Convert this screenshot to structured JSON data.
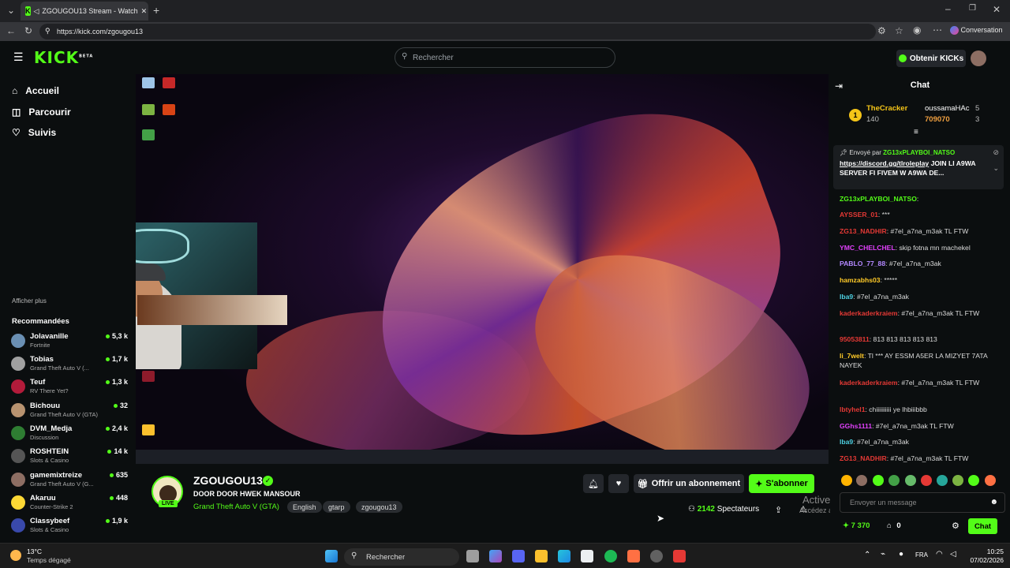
{
  "browser": {
    "tab_title": "ZGOUGOU13 Stream - Watch",
    "url": "https://kick.com/zgougou13",
    "conversation": "Conversation"
  },
  "header": {
    "logo": "KICK",
    "logo_sup": "BETA",
    "search_placeholder": "Rechercher",
    "kicks_button": "Obtenir KICKs"
  },
  "nav": {
    "home": "Accueil",
    "browse": "Parcourir",
    "following": "Suivis",
    "show_more": "Afficher plus",
    "recommended_title": "Recommandées"
  },
  "recommended": [
    {
      "name": "Jolavanille",
      "category": "Fortnite",
      "viewers": "5,3 k",
      "color": "#6a8fb3"
    },
    {
      "name": "Tobias",
      "category": "Grand Theft Auto V (...",
      "viewers": "1,7 k",
      "color": "#a0a0a0"
    },
    {
      "name": "Teuf",
      "category": "RV There Yet?",
      "viewers": "1,3 k",
      "color": "#b31b3a"
    },
    {
      "name": "Bichouu",
      "category": "Grand Theft Auto V (GTA)",
      "viewers": "32",
      "color": "#b89370"
    },
    {
      "name": "DVM_Medja",
      "category": "Discussion",
      "viewers": "2,4 k",
      "color": "#2e7d32"
    },
    {
      "name": "ROSHTEIN",
      "category": "Slots & Casino",
      "viewers": "14 k",
      "color": "#555"
    },
    {
      "name": "gamemixtreize",
      "category": "Grand Theft Auto V (G...",
      "viewers": "635",
      "color": "#8d6e63"
    },
    {
      "name": "Akaruu",
      "category": "Counter-Strike 2",
      "viewers": "448",
      "color": "#fdd835"
    },
    {
      "name": "Classybeef",
      "category": "Slots & Casino",
      "viewers": "1,9 k",
      "color": "#3949ab"
    }
  ],
  "stream": {
    "streamer": "ZGOUGOU13",
    "title": "DOOR DOOR HWEK MANSOUR",
    "category": "Grand Theft Auto V (GTA)",
    "tags": [
      "English",
      "gtarp",
      "zgougou13"
    ],
    "live": "LIVE",
    "gift_button": "Offrir un abonnement",
    "subscribe_button": "S'abonner",
    "viewers_count": "2142",
    "viewers_label": "Spectateurs"
  },
  "watermark": {
    "line1": "Activer Windows",
    "line2": "Accédez aux paramètres pour activer Windows."
  },
  "chat": {
    "title": "Chat",
    "leaderboard": [
      {
        "rank": "1",
        "name": "TheCracker",
        "value": "140"
      },
      {
        "name": "oussamaHAc",
        "value": "5"
      },
      {
        "name": "",
        "value": "709070",
        "extra": "3"
      }
    ],
    "pinned": {
      "sent_by": "Envoyé par",
      "user": "ZG13xPLAYBOI_NATSO",
      "link": "https://discord.gg/tlroleplay",
      "text": "JOIN LI A9WA SERVER FI FIVEM W A9WA DE..."
    },
    "messages": [
      {
        "user": "ZG13xPLAYBOI_NATSO",
        "text": ":",
        "color": "#53fc18"
      },
      {
        "user": "AYSSER_01",
        "text": ": ***",
        "color": "#e53935"
      },
      {
        "user": "ZG13_NADHIR",
        "text": ": #7el_a7na_m3ak TL FTW",
        "color": "#e53935"
      },
      {
        "user": "YMC_CHELCHEL",
        "text": ": skip fotna mn machekel",
        "color": "#e040fb"
      },
      {
        "user": "PABLO_77_88",
        "text": ": #7el_a7na_m3ak",
        "color": "#b388ff"
      },
      {
        "user": "hamzabhs03",
        "text": ": *****",
        "color": "#ffca28"
      },
      {
        "user": "lba9",
        "text": ": #7el_a7na_m3ak",
        "color": "#4dd0e1"
      },
      {
        "user": "kaderkaderkraiem",
        "text": ": #7el_a7na_m3ak TL FTW",
        "color": "#e53935"
      },
      {
        "user": "95053811",
        "text": ": 813 813 813 813 813",
        "color": "#e53935"
      },
      {
        "user": "li_7welt",
        "text": ": Tl *** AY ESSM A5ER LA MIZYET 7ATA NAYEK",
        "color": "#ffca28"
      },
      {
        "user": "kaderkaderkraiem",
        "text": ": #7el_a7na_m3ak TL FTW",
        "color": "#e53935"
      },
      {
        "user": "lbtyhel1",
        "text": ": chiiiiiiiiii ye lhbiiibbb",
        "color": "#e53935"
      },
      {
        "user": "GGhs1111",
        "text": ": #7el_a7na_m3ak TL FTW",
        "color": "#e040fb"
      },
      {
        "user": "lba9",
        "text": ": #7el_a7na_m3ak",
        "color": "#4dd0e1"
      },
      {
        "user": "ZG13_NADHIR",
        "text": ": #7el_a7na_m3ak TL FTW",
        "color": "#e53935"
      }
    ],
    "input_placeholder": "Envoyer un message",
    "points": "7 370",
    "store": "0",
    "send_button": "Chat"
  },
  "taskbar": {
    "temp": "13°C",
    "weather": "Temps dégagé",
    "search": "Rechercher",
    "lang": "FRA",
    "time": "10:25",
    "date": "07/02/2026"
  },
  "colors": {
    "accent": "#53fc18",
    "bg": "#0b0e0f"
  }
}
